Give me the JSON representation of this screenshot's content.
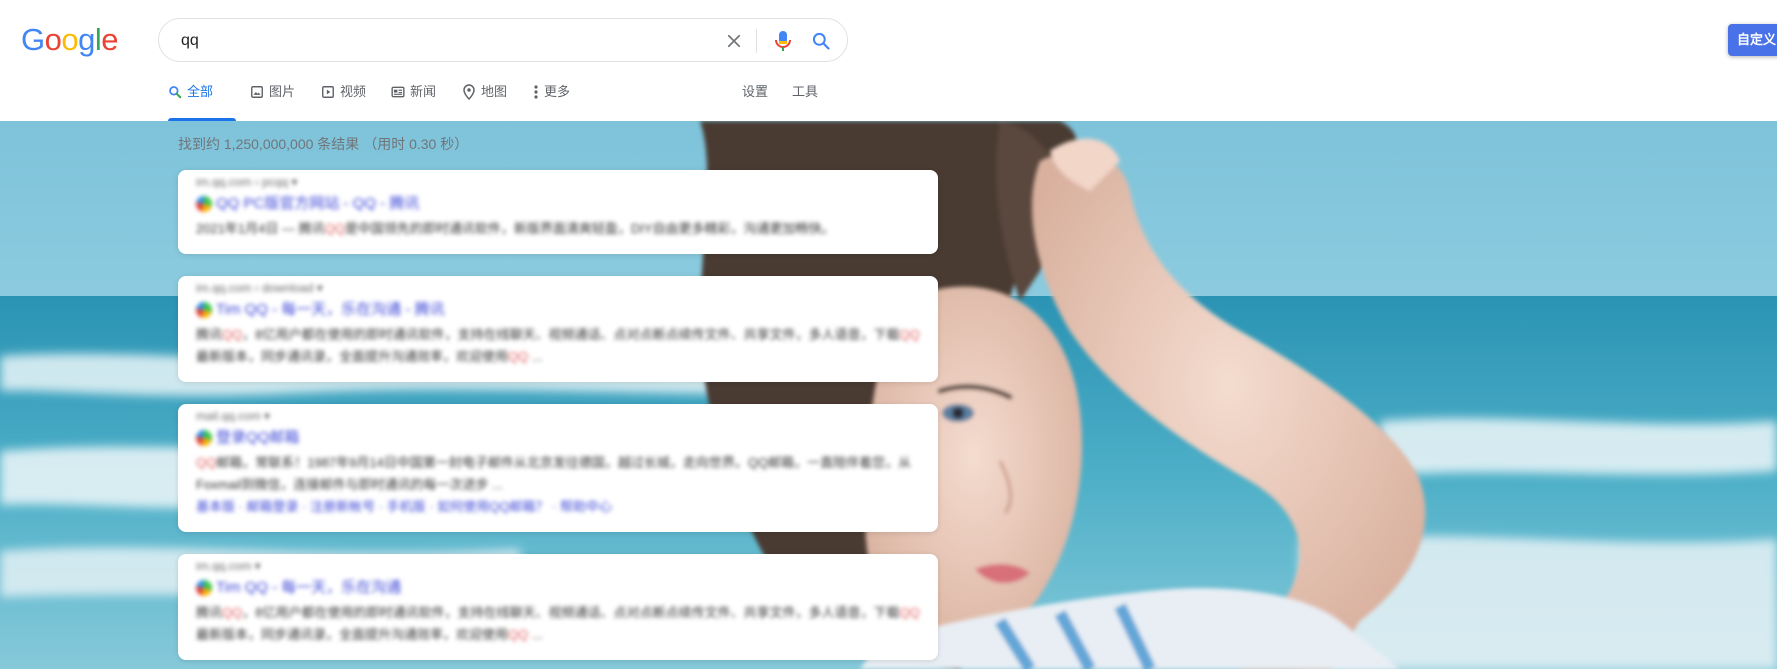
{
  "logo": {
    "letters": [
      "G",
      "o",
      "o",
      "g",
      "l",
      "e"
    ],
    "colors": [
      "#4285f4",
      "#ea4335",
      "#fbbc05",
      "#4285f4",
      "#34a853",
      "#ea4335"
    ]
  },
  "search": {
    "query": "qq"
  },
  "icons": {
    "clear": "close-icon",
    "voice": "microphone-icon",
    "search": "search-icon"
  },
  "tabs": [
    {
      "label": "全部",
      "icon": "search-icon",
      "active": true
    },
    {
      "label": "图片",
      "icon": "image-icon",
      "active": false
    },
    {
      "label": "视频",
      "icon": "video-icon",
      "active": false
    },
    {
      "label": "新闻",
      "icon": "news-icon",
      "active": false
    },
    {
      "label": "地图",
      "icon": "map-pin-icon",
      "active": false
    },
    {
      "label": "更多",
      "icon": "more-vert-icon",
      "active": false
    }
  ],
  "tools": {
    "settings": "设置",
    "tools": "工具"
  },
  "custom_button": "自定义",
  "stats": "找到约 1,250,000,000 条结果 （用时 0.30 秒）",
  "colors": {
    "accent": "#1a73e8",
    "link": "#3b46d6",
    "custom_button": "#4a72e8"
  },
  "results": [
    {
      "url": "im.qq.com › pcqq ▾",
      "title": "QQ PC版官方网站 - QQ - 腾讯",
      "snippet": [
        {
          "t": "2021年1月4日 — 腾讯",
          "hl": false
        },
        {
          "t": "QQ",
          "hl": true
        },
        {
          "t": "是中国领先的即时通讯软件，新版界面清爽轻盈，DIY自由更多精彩，沟通更加畅快。",
          "hl": false
        }
      ],
      "links": ""
    },
    {
      "url": "im.qq.com › download ▾",
      "title": "Tim QQ - 每一天，乐在沟通 - 腾讯",
      "snippet": [
        {
          "t": "腾讯",
          "hl": false
        },
        {
          "t": "QQ",
          "hl": true
        },
        {
          "t": "，8亿用户都在使用的即时通讯软件，支持在线聊天、视频通话、点对点断点续传文件、共享文件，多人语音，下载",
          "hl": false
        },
        {
          "t": "QQ",
          "hl": true
        },
        {
          "t": "最新版本，同步通讯录，全面提升沟通效率，欢迎使用",
          "hl": false
        },
        {
          "t": "QQ",
          "hl": true
        },
        {
          "t": " ...",
          "hl": false
        }
      ],
      "links": ""
    },
    {
      "url": "mail.qq.com ▾",
      "title": "登录QQ邮箱",
      "snippet": [
        {
          "t": "QQ",
          "hl": true
        },
        {
          "t": "邮箱，常联系！1987年9月14日中国第一封电子邮件从北京发往德国，越过长城，走向世界。QQ邮箱，一直陪伴着您，从Foxmail到微信，连接邮件与即时通讯的每一次进步 ...",
          "hl": false
        }
      ],
      "links": "基本版 · 邮箱登录 · 注册新帐号 · 手机版 · 如何使用QQ邮箱？ · 帮助中心"
    },
    {
      "url": "im.qq.com ▾",
      "title": "Tim QQ - 每一天，乐在沟通",
      "snippet": [
        {
          "t": "腾讯",
          "hl": false
        },
        {
          "t": "QQ",
          "hl": true
        },
        {
          "t": "，8亿用户都在使用的即时通讯软件，支持在线聊天、视频通话、点对点断点续传文件、共享文件，多人语音，下载",
          "hl": false
        },
        {
          "t": "QQ",
          "hl": true
        },
        {
          "t": "最新版本，同步通讯录，全面提升沟通效率，欢迎使用",
          "hl": false
        },
        {
          "t": "QQ",
          "hl": true
        },
        {
          "t": " ...",
          "hl": false
        }
      ],
      "links": ""
    }
  ]
}
